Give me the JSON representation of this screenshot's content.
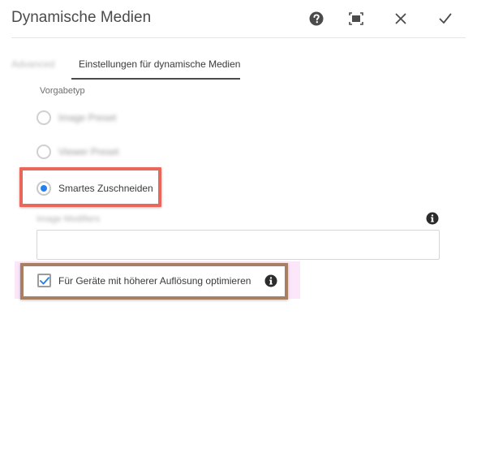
{
  "dialog": {
    "title": "Dynamische Medien"
  },
  "header_buttons": [
    {
      "name": "help",
      "icon": "help-icon"
    },
    {
      "name": "fullscreen",
      "icon": "fullscreen-icon"
    },
    {
      "name": "close",
      "icon": "close-icon"
    },
    {
      "name": "done",
      "icon": "check-icon"
    }
  ],
  "tabs": [
    {
      "label": "Advanced",
      "active": false
    },
    {
      "label": "Einstellungen für dynamische Medien",
      "active": true
    }
  ],
  "preset_type": {
    "label": "Vorgabetyp",
    "options": [
      {
        "label": "Image Preset",
        "checked": false
      },
      {
        "label": "Viewer Preset",
        "checked": false
      },
      {
        "label": "Smartes Zuschneiden",
        "checked": true
      }
    ]
  },
  "image_modifier": {
    "label": "Image Modifiers",
    "value": ""
  },
  "optimize_checkbox": {
    "label": "Für Geräte mit höherer Auflösung optimieren",
    "checked": true
  },
  "colors": {
    "accent": "#2680eb",
    "highlight_red": "#e8675a",
    "highlight_brown": "#a87f62",
    "highlight_pink": "#fbe6fa"
  }
}
